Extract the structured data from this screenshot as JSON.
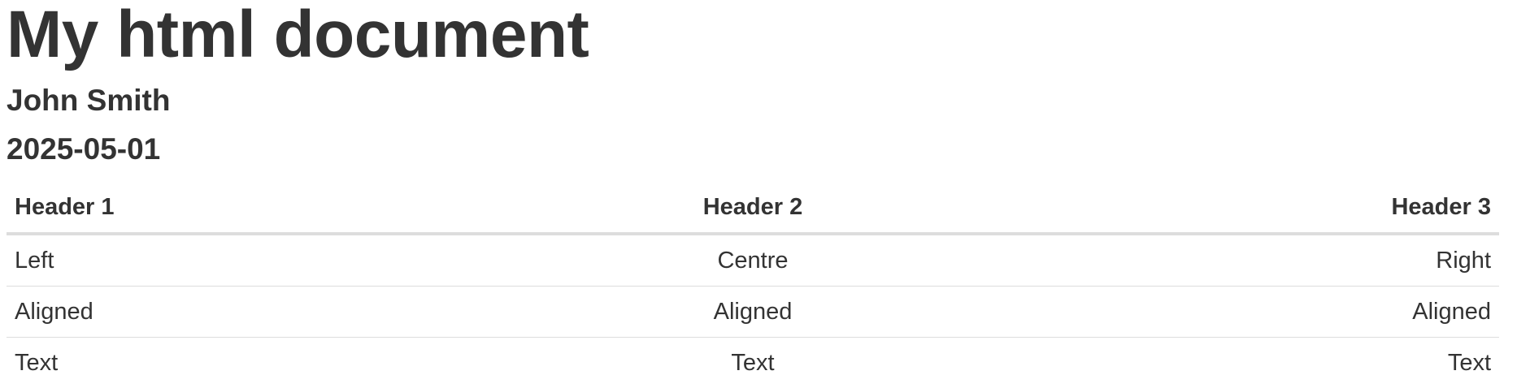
{
  "document": {
    "title": "My html document",
    "author": "John Smith",
    "date": "2025-05-01"
  },
  "table": {
    "headers": [
      "Header 1",
      "Header 2",
      "Header 3"
    ],
    "alignments": [
      "left",
      "center",
      "right"
    ],
    "rows": [
      [
        "Left",
        "Centre",
        "Right"
      ],
      [
        "Aligned",
        "Aligned",
        "Aligned"
      ],
      [
        "Text",
        "Text",
        "Text"
      ]
    ]
  },
  "colors": {
    "text": "#333333",
    "rule": "#dddddd",
    "background": "#ffffff"
  }
}
